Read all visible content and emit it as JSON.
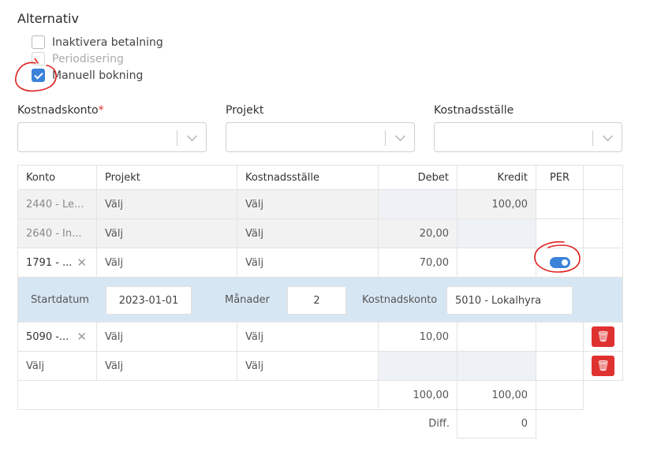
{
  "options": {
    "title": "Alternativ",
    "checkboxes": [
      {
        "label": "Inaktivera betalning",
        "checked": false,
        "disabled": false
      },
      {
        "label": "Periodisering",
        "checked": false,
        "disabled": true
      },
      {
        "label": "Manuell bokning",
        "checked": true,
        "disabled": false
      }
    ]
  },
  "filters": {
    "kostnadskonto": {
      "label": "Kostnadskonto",
      "required_mark": "*",
      "value": ""
    },
    "projekt": {
      "label": "Projekt",
      "value": ""
    },
    "kostnadsstalle": {
      "label": "Kostnadsställe",
      "value": ""
    }
  },
  "table": {
    "headers": {
      "konto": "Konto",
      "projekt": "Projekt",
      "kostnadsstalle": "Kostnadsställe",
      "debet": "Debet",
      "kredit": "Kredit",
      "per": "PER"
    },
    "rows": [
      {
        "konto": "2440 - Le...",
        "projekt": "Välj",
        "kostnadsstalle": "Välj",
        "debet": "",
        "kredit": "100,00"
      },
      {
        "konto": "2640 - In...",
        "projekt": "Välj",
        "kostnadsstalle": "Välj",
        "debet": "20,00",
        "kredit": ""
      },
      {
        "konto": "1791 - ...",
        "projekt": "Välj",
        "kostnadsstalle": "Välj",
        "debet": "70,00",
        "kredit": "",
        "per_toggle": true
      },
      {
        "konto": "5090 -...",
        "projekt": "Välj",
        "kostnadsstalle": "Välj",
        "debet": "10,00",
        "kredit": ""
      },
      {
        "konto": "Välj",
        "projekt": "Välj",
        "kostnadsstalle": "Välj",
        "debet": "",
        "kredit": ""
      }
    ],
    "periodization": {
      "startdatum_label": "Startdatum",
      "startdatum_value": "2023-01-01",
      "manader_label": "Månader",
      "manader_value": "2",
      "kostnadskonto_label": "Kostnadskonto",
      "kostnadskonto_value": "5010 - Lokalhyra"
    },
    "totals": {
      "debet": "100,00",
      "kredit": "100,00"
    },
    "diff": {
      "label": "Diff.",
      "value": "0"
    }
  },
  "colors": {
    "accent": "#3b82d9",
    "danger": "#e03131",
    "period_row": "#d7e6f3",
    "annotation": "#e02020"
  },
  "icons": {
    "clear": "close-icon",
    "delete": "trash-icon",
    "dropdown": "chevron-down-icon"
  }
}
